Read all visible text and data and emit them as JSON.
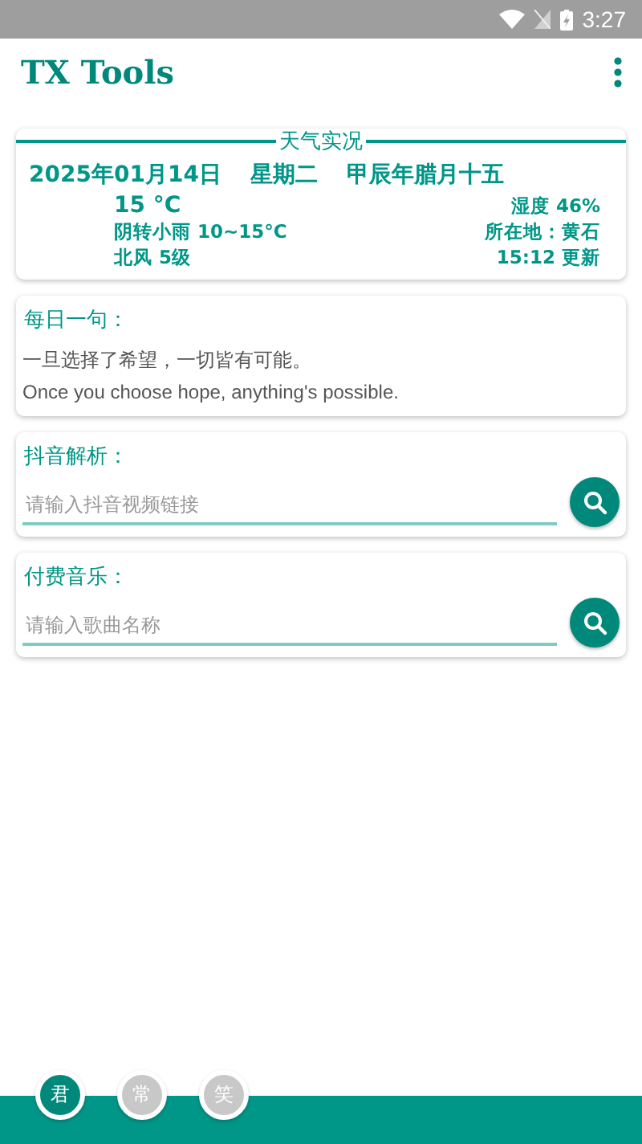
{
  "status_bar": {
    "time": "3:27"
  },
  "app_bar": {
    "title": "TX Tools"
  },
  "weather": {
    "heading": "天气实况",
    "date": "2025年01月14日",
    "weekday": "星期二",
    "lunar": "甲辰年腊月十五",
    "temperature": "15 °C",
    "humidity": "湿度 46%",
    "forecast": "阴转小雨 10~15°C",
    "location": "所在地：黄石",
    "wind": "北风 5级",
    "updated": "15:12 更新"
  },
  "quote": {
    "label": "每日一句：",
    "chinese": "一旦选择了希望，一切皆有可能。",
    "english": "Once you choose hope, anything's possible."
  },
  "searches": [
    {
      "label": "抖音解析：",
      "placeholder": "请输入抖音视频链接"
    },
    {
      "label": "付费音乐：",
      "placeholder": "请输入歌曲名称"
    }
  ],
  "bottom_tabs": [
    {
      "label": "君",
      "selected": true
    },
    {
      "label": "常",
      "selected": false
    },
    {
      "label": "笑",
      "selected": false
    }
  ]
}
